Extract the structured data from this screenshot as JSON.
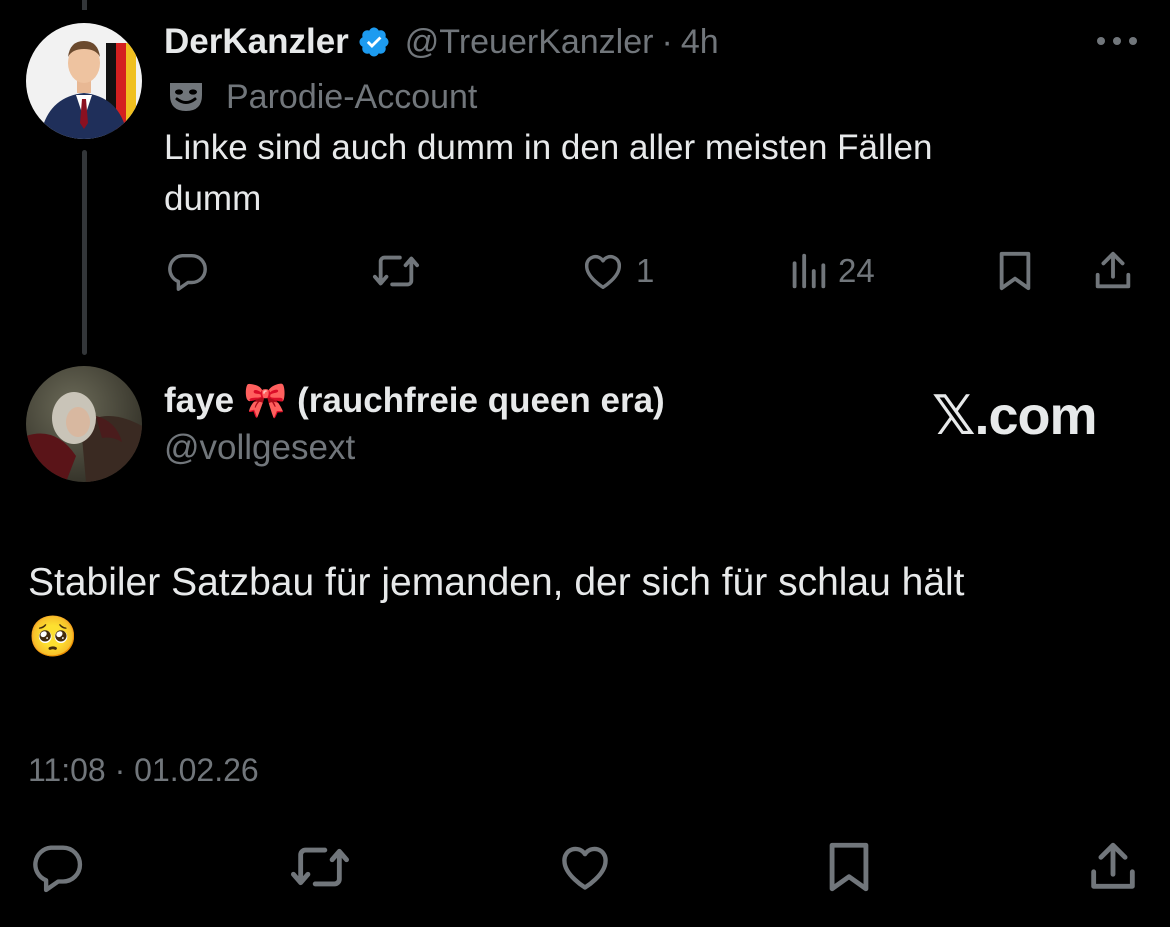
{
  "parent_tweet": {
    "display_name": "DerKanzler",
    "verified": true,
    "handle": "@TreuerKanzler",
    "separator": "·",
    "time_ago": "4h",
    "parody_label": "Parodie-Account",
    "text_line1": "Linke sind auch dumm in den aller meisten Fällen",
    "text_line2": "dumm",
    "likes": "1",
    "views": "24"
  },
  "reply": {
    "display_name": "faye 🎀 (rauchfreie queen era)",
    "handle": "@vollgesext",
    "watermark": "𝕏.com",
    "text_line1": "Stabiler Satzbau für jemanden, der sich für schlau hält",
    "text_line2": "🥺",
    "timestamp": "11:08 · 01.02.26"
  },
  "colors": {
    "background": "#000000",
    "text": "#e7e9ea",
    "muted": "#71767b",
    "verified": "#1d9bf0"
  },
  "icons": [
    "reply-icon",
    "retweet-icon",
    "like-icon",
    "views-icon",
    "bookmark-icon",
    "share-icon",
    "more-icon",
    "verified-icon",
    "parody-mask-icon"
  ]
}
